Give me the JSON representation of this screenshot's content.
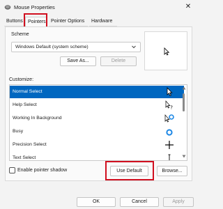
{
  "window": {
    "title": "Mouse Properties"
  },
  "tabs": [
    {
      "label": "Buttons"
    },
    {
      "label": "Pointers"
    },
    {
      "label": "Pointer Options"
    },
    {
      "label": "Hardware"
    }
  ],
  "scheme": {
    "label": "Scheme",
    "selected": "Windows Default (system scheme)",
    "save_as": "Save As...",
    "delete": "Delete"
  },
  "customize": {
    "label": "Customize:",
    "items": [
      {
        "label": "Normal Select",
        "icon": "arrow-cursor-icon"
      },
      {
        "label": "Help Select",
        "icon": "help-cursor-icon"
      },
      {
        "label": "Working In Background",
        "icon": "working-cursor-icon"
      },
      {
        "label": "Busy",
        "icon": "busy-ring-icon"
      },
      {
        "label": "Precision Select",
        "icon": "crosshair-icon"
      },
      {
        "label": "Text Select",
        "icon": "ibeam-icon"
      }
    ]
  },
  "options": {
    "shadow_label": "Enable pointer shadow",
    "use_default": "Use Default",
    "browse": "Browse..."
  },
  "dialog": {
    "ok": "OK",
    "cancel": "Cancel",
    "apply": "Apply"
  },
  "colors": {
    "accent": "#0067c0",
    "highlight_box": "#d10f1f"
  }
}
